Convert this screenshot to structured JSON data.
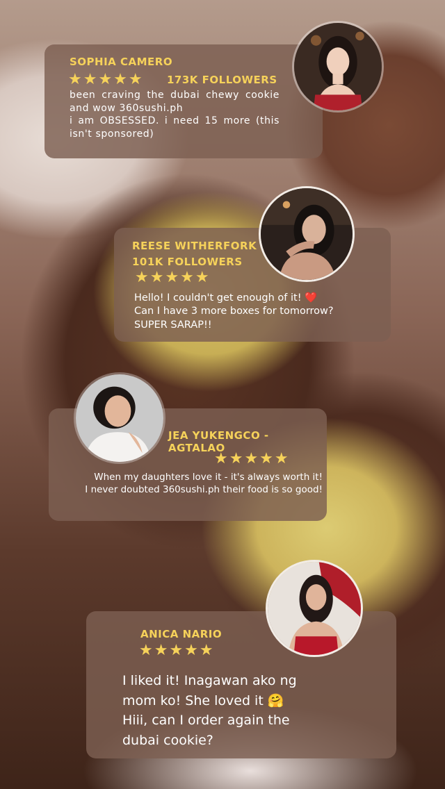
{
  "reviews": [
    {
      "name": "SOPHIA CAMERO",
      "stars": "★★★★★",
      "followers": "173K FOLLOWERS",
      "text": "been craving the dubai chewy cookie and wow 360sushi.ph\ni am OBSESSED. i need 15 more (this isn't sponsored)"
    },
    {
      "name": "REESE WITHERFORK",
      "followers": "101K FOLLOWERS",
      "stars": "★★★★★",
      "text": "Hello!  I couldn't get enough of it! ❤️\nCan I have 3 more boxes for tomorrow?\nSUPER SARAP!!"
    },
    {
      "name": "JEA YUKENGCO - AGTALAO",
      "stars": "★★★★★",
      "text": "When my daughters love it - it's always worth it!\nI never doubted 360sushi.ph their food is so good!"
    },
    {
      "name": "ANICA NARIO",
      "stars": "★★★★★",
      "text": "I liked it! Inagawan ako ng\nmom ko! She loved it 🤗\nHiii, can I order again the\ndubai cookie?"
    }
  ],
  "colors": {
    "accent": "#f6d25a",
    "card": "#7d5f52",
    "text": "#ffffff"
  }
}
